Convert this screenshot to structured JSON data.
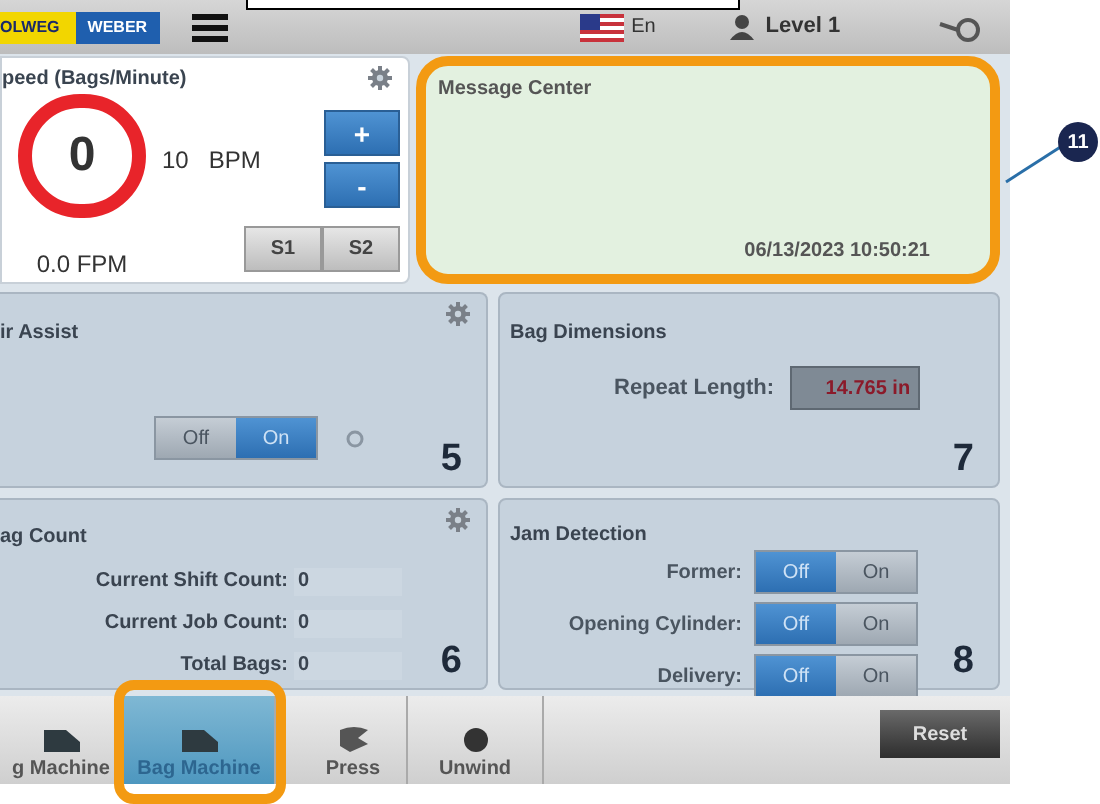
{
  "header": {
    "logo": [
      {
        "text": "OLWEG",
        "kind": "yellow"
      },
      {
        "text": "WEBER",
        "kind": "blue"
      }
    ],
    "language": "En",
    "user_level": "Level 1"
  },
  "speed": {
    "title": "peed (Bags/Minute)",
    "gauge_value": "0",
    "set_value": "10",
    "unit": "BPM",
    "increase": "+",
    "decrease": "-",
    "fpm": "0.0 FPM",
    "presets": [
      "S1",
      "S2"
    ]
  },
  "message_center": {
    "title": "Message Center",
    "timestamp": "06/13/2023 10:50:21",
    "highlighted": true
  },
  "air_assist": {
    "title": "ir Assist",
    "toggle": [
      {
        "label": "Off",
        "selected": false
      },
      {
        "label": "On",
        "selected": true
      }
    ],
    "number": "5"
  },
  "bag_dimensions": {
    "title": "Bag Dimensions",
    "label": "Repeat Length:",
    "value": "14.765 in",
    "number": "7"
  },
  "bag_count": {
    "title": "ag Count",
    "rows": [
      {
        "label": "Current Shift Count:",
        "value": "0"
      },
      {
        "label": "Current Job Count:",
        "value": "0"
      },
      {
        "label": "Total Bags:",
        "value": "0"
      }
    ],
    "number": "6"
  },
  "jam_detection": {
    "title": "Jam Detection",
    "rows": [
      {
        "label": "Former:",
        "toggle": [
          {
            "label": "Off",
            "selected": true
          },
          {
            "label": "On",
            "selected": false
          }
        ]
      },
      {
        "label": "Opening Cylinder:",
        "toggle": [
          {
            "label": "Off",
            "selected": true
          },
          {
            "label": "On",
            "selected": false
          }
        ]
      },
      {
        "label": "Delivery:",
        "toggle": [
          {
            "label": "Off",
            "selected": true
          },
          {
            "label": "On",
            "selected": false
          }
        ]
      }
    ],
    "number": "8"
  },
  "bottom_tabs": [
    {
      "label": "g Machine",
      "kind": "machine",
      "selected": false,
      "highlighted": false
    },
    {
      "label": "Bag Machine",
      "kind": "machine",
      "selected": true,
      "highlighted": true
    },
    {
      "label": "Press",
      "kind": "press",
      "selected": false,
      "highlighted": false
    },
    {
      "label": "Unwind",
      "kind": "unwind",
      "selected": false,
      "highlighted": false
    }
  ],
  "reset_button": "Reset",
  "callout": "11"
}
